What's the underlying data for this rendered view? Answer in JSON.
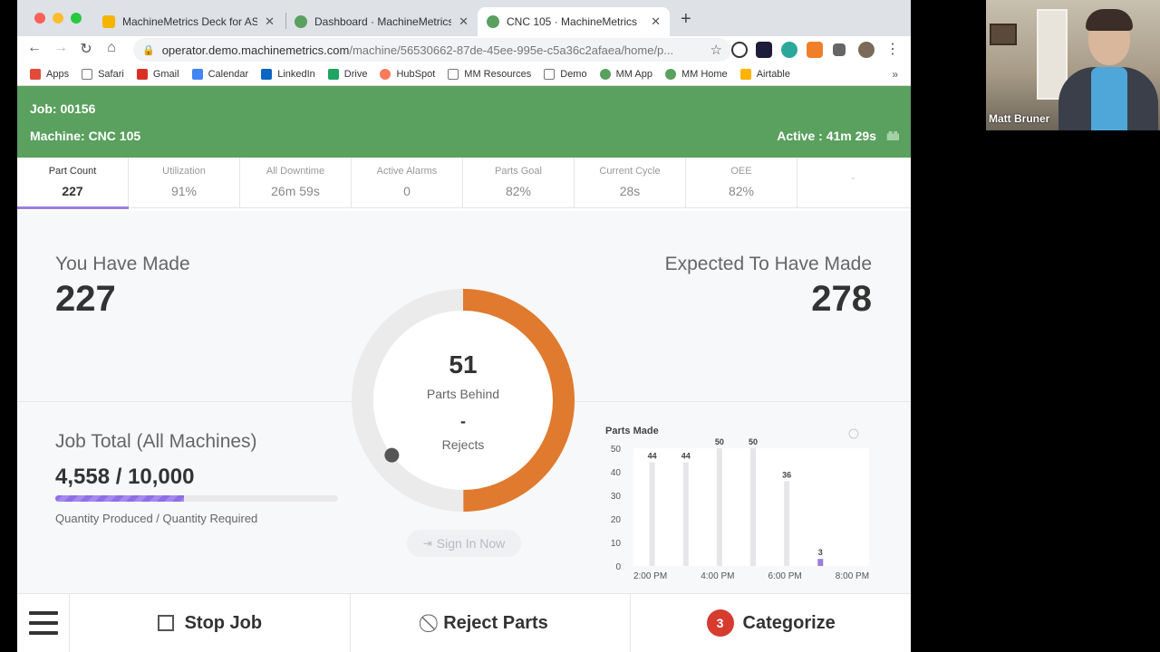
{
  "browser": {
    "tabs": [
      {
        "title": "MachineMetrics Deck for ASQ",
        "favicon_color": "#f4b400"
      },
      {
        "title": "Dashboard · MachineMetrics",
        "favicon_color": "#5aa05f"
      },
      {
        "title": "CNC 105 · MachineMetrics",
        "favicon_color": "#5aa05f"
      }
    ],
    "url_host": "operator.demo.machinemetrics.com",
    "url_path": "/machine/56530662-87de-45ee-995e-c5a36c2afaea/home/p...",
    "bookmarks": [
      {
        "label": "Apps",
        "color": "#e24a3a"
      },
      {
        "label": "Safari",
        "color": "#777777"
      },
      {
        "label": "Gmail",
        "color": "#d93025"
      },
      {
        "label": "Calendar",
        "color": "#4285f4"
      },
      {
        "label": "LinkedIn",
        "color": "#0a66c2"
      },
      {
        "label": "Drive",
        "color": "#1fa463"
      },
      {
        "label": "HubSpot",
        "color": "#ff7a59"
      },
      {
        "label": "MM Resources",
        "color": "#777777"
      },
      {
        "label": "Demo",
        "color": "#777777"
      },
      {
        "label": "MM App",
        "color": "#5aa05f"
      },
      {
        "label": "MM Home",
        "color": "#5aa05f"
      },
      {
        "label": "Airtable",
        "color": "#fcb400"
      }
    ],
    "bookmarks_more": "»"
  },
  "header": {
    "job": "Job: 00156",
    "machine": "Machine: CNC 105",
    "active": "Active : 41m 29s",
    "color": "#5aa05f"
  },
  "stats": [
    {
      "label": "Part Count",
      "value": "227"
    },
    {
      "label": "Utilization",
      "value": "91%"
    },
    {
      "label": "All Downtime",
      "value": "26m 59s"
    },
    {
      "label": "Active Alarms",
      "value": "0"
    },
    {
      "label": "Parts Goal",
      "value": "82%"
    },
    {
      "label": "Current Cycle",
      "value": "28s"
    },
    {
      "label": "OEE",
      "value": "82%"
    },
    {
      "label": "",
      "value": "-"
    }
  ],
  "made": {
    "label": "You Have Made",
    "value": "227"
  },
  "expected": {
    "label": "Expected To Have Made",
    "value": "278"
  },
  "donut": {
    "behind_value": "51",
    "behind_label": "Parts Behind",
    "rejects_value": "-",
    "rejects_label": "Rejects",
    "progress_fraction": 0.5,
    "accent": "#e07a2e"
  },
  "job_total": {
    "label": "Job Total (All Machines)",
    "value": "4,558 / 10,000",
    "fraction": 0.4558,
    "sub": "Quantity Produced / Quantity Required"
  },
  "signin_label": "Sign In Now",
  "chart_data": {
    "type": "bar",
    "title": "Parts Made",
    "ylim": [
      0,
      50
    ],
    "yticks": [
      "0",
      "10",
      "20",
      "30",
      "40",
      "50"
    ],
    "xticks": [
      "2:00 PM",
      "4:00 PM",
      "6:00 PM",
      "8:00 PM"
    ],
    "x": [
      2,
      3,
      4,
      5,
      6,
      7
    ],
    "values": [
      44,
      44,
      50,
      50,
      36,
      3
    ],
    "labels": [
      "44",
      "44",
      "50",
      "50",
      "36",
      "3"
    ],
    "bar_color": "#e6e6e8",
    "current_color": "#9b7ee0"
  },
  "actions": {
    "stop": "Stop Job",
    "reject": "Reject Parts",
    "categorize_badge": "3",
    "categorize": "Categorize"
  },
  "video": {
    "name": "Matt Bruner"
  }
}
